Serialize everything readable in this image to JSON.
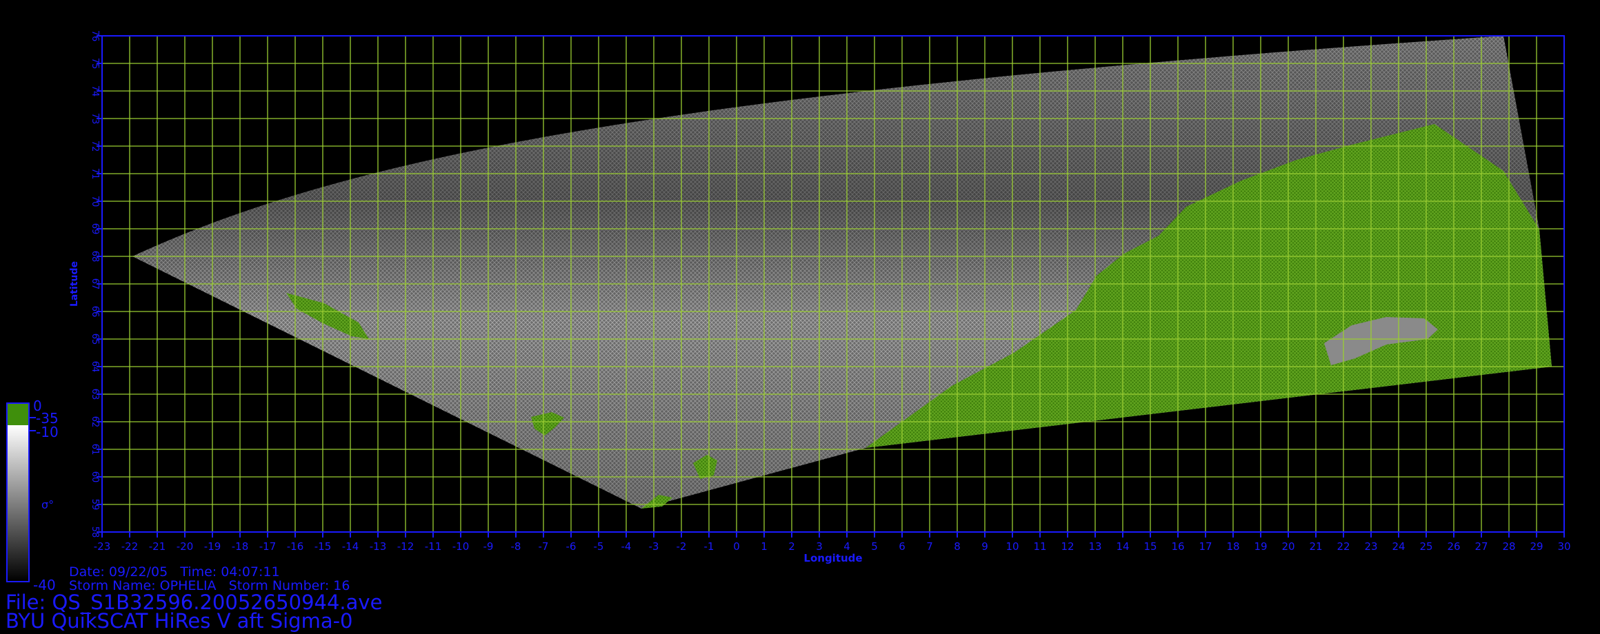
{
  "map": {
    "x_label": "Longitude",
    "y_label": "Latitude",
    "lon_range": [
      -23,
      30
    ],
    "lat_range": [
      58,
      76
    ],
    "grid": true,
    "grid_color": "#9acd32",
    "axis_color": "#1a1aff",
    "land_color": "#4a8c10"
  },
  "colorbar": {
    "label": "σ°",
    "top_value": "0",
    "mid_value_1": "-35",
    "mid_value_2": "-10",
    "bottom_value": "-40"
  },
  "info": {
    "line1": "Date: 09/22/05   Time: 04:07:11",
    "line2": "Storm Name: OPHELIA   Storm Number: 16",
    "file_line": "File: QS_S1B32596.20052650944.ave",
    "product_line": "BYU QuikSCAT HiRes V aft Sigma-0"
  }
}
